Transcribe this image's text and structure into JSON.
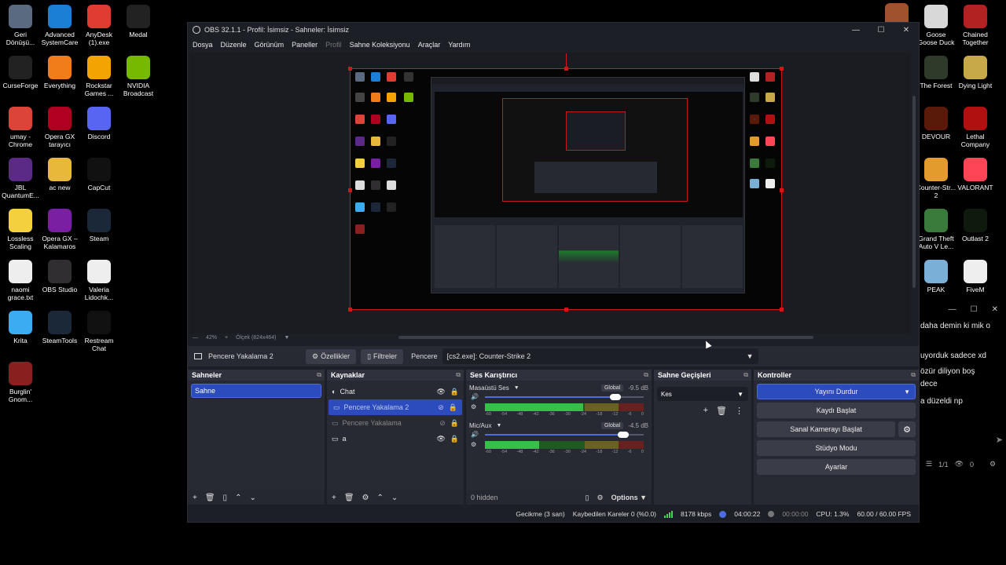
{
  "desktop_left": [
    {
      "label": "Geri Dönüşü...",
      "icon": "recycle-bin-icon",
      "color": "#5a6a80"
    },
    {
      "label": "Advanced SystemCare",
      "icon": "advanced-systemcare-icon",
      "color": "#1c7fd6"
    },
    {
      "label": "AnyDesk (1).exe",
      "icon": "anydesk-icon",
      "color": "#e03c31"
    },
    {
      "label": "Medal",
      "icon": "medal-icon",
      "color": "#222"
    },
    {
      "label": "CurseForge",
      "icon": "curseforge-icon",
      "color": "#222"
    },
    {
      "label": "Everything",
      "icon": "everything-icon",
      "color": "#f07c1a"
    },
    {
      "label": "Rockstar Games ...",
      "icon": "rockstar-icon",
      "color": "#f4a400"
    },
    {
      "label": "NVIDIA Broadcast",
      "icon": "nvidia-broadcast-icon",
      "color": "#76b900"
    },
    {
      "label": "umay - Chrome",
      "icon": "chrome-icon",
      "color": "#db4437"
    },
    {
      "label": "Opera GX tarayıcı",
      "icon": "opera-gx-icon",
      "color": "#b00020"
    },
    {
      "label": "Discord",
      "icon": "discord-icon",
      "color": "#5865f2"
    },
    {
      "label": "JBL QuantumE...",
      "icon": "jbl-icon",
      "color": "#5b2a86"
    },
    {
      "label": "ac new",
      "icon": "folder-icon",
      "color": "#e8b83a"
    },
    {
      "label": "CapCut",
      "icon": "capcut-icon",
      "color": "#111"
    },
    {
      "label": "Lossless Scaling",
      "icon": "lossless-scaling-icon",
      "color": "#f4d03f"
    },
    {
      "label": "Opera GX – Kalamaros",
      "icon": "opera-gx-icon",
      "color": "#7a1fa2"
    },
    {
      "label": "Steam",
      "icon": "steam-icon",
      "color": "#1b2838"
    },
    {
      "label": "naomi grace.txt",
      "icon": "text-file-icon",
      "color": "#eeeeee"
    },
    {
      "label": "OBS Studio",
      "icon": "obs-icon",
      "color": "#302e31"
    },
    {
      "label": "Valeria Lidochk...",
      "icon": "text-file-icon",
      "color": "#eeeeee"
    },
    {
      "label": "Krita",
      "icon": "krita-icon",
      "color": "#3babf2"
    },
    {
      "label": "SteamTools",
      "icon": "steamtools-icon",
      "color": "#1b2838"
    },
    {
      "label": "Restream Chat",
      "icon": "restream-icon",
      "color": "#111"
    },
    {
      "label": "Burglin' Gnom...",
      "icon": "burglin-gnomes-icon",
      "color": "#8a1f1f"
    }
  ],
  "desktop_right": [
    {
      "label": "",
      "icon": "game-icon",
      "color": "#a0522d"
    },
    {
      "label": "Goose Goose Duck",
      "icon": "goose-goose-duck-icon",
      "color": "#d8d8d8"
    },
    {
      "label": "Chained Together",
      "icon": "chained-together-icon",
      "color": "#b22222"
    },
    {
      "label": "The Forest",
      "icon": "the-forest-icon",
      "color": "#2e3b2a"
    },
    {
      "label": "Dying Light",
      "icon": "dying-light-icon",
      "color": "#c8a94a"
    },
    {
      "label": "DEVOUR",
      "icon": "devour-icon",
      "color": "#5a1a0a"
    },
    {
      "label": "Lethal Company",
      "icon": "lethal-company-icon",
      "color": "#b01010"
    },
    {
      "label": "Counter-Str... 2",
      "icon": "counter-strike-icon",
      "color": "#e39b2d"
    },
    {
      "label": "VALORANT",
      "icon": "valorant-icon",
      "color": "#fd4556"
    },
    {
      "label": "Grand Theft Auto V Le...",
      "icon": "gta-icon",
      "color": "#3a7a3a"
    },
    {
      "label": "Outlast 2",
      "icon": "outlast-icon",
      "color": "#0e1a0e"
    },
    {
      "label": "PEAK",
      "icon": "peak-icon",
      "color": "#7ab0d8"
    },
    {
      "label": "FiveM",
      "icon": "fivem-icon",
      "color": "#eeeeee"
    }
  ],
  "chat": {
    "lines": [
      "daha demin ki mik o",
      "uyorduk sadece xd",
      "özür diliyon boş",
      "dece",
      "a düzeldi np"
    ],
    "footer_count": "1/1",
    "footer_viewers": "0"
  },
  "obs": {
    "title": "OBS 32.1.1 - Profil: İsimsiz - Sahneler: İsimsiz",
    "menu": [
      "Dosya",
      "Düzenle",
      "Görünüm",
      "Paneller",
      "Profil",
      "Sahne Koleksiyonu",
      "Araçlar",
      "Yardım"
    ],
    "zoom": "42%",
    "scale_label": "Ölçek (824x464)",
    "context": {
      "source_name": "Pencere Yakalama 2",
      "properties": "Özellikler",
      "filters": "Filtreler",
      "window_label": "Pencere",
      "window_value": "[cs2.exe]: Counter-Strike 2"
    },
    "scenes": {
      "title": "Sahneler",
      "items": [
        "Sahne"
      ]
    },
    "sources": {
      "title": "Kaynaklar",
      "items": [
        {
          "name": "Chat",
          "icon": "browser-icon",
          "state": "normal"
        },
        {
          "name": "Pencere Yakalama 2",
          "icon": "window-icon",
          "state": "selected"
        },
        {
          "name": "Pencere Yakalama",
          "icon": "window-icon",
          "state": "hidden"
        },
        {
          "name": "a",
          "icon": "monitor-icon",
          "state": "normal"
        }
      ]
    },
    "mixer": {
      "title": "Ses Karıştırıcı",
      "channels": [
        {
          "name": "Masaüstü Ses",
          "badge": "Global",
          "db": "-9.5 dB",
          "volume": 0.82,
          "level": 0.62
        },
        {
          "name": "Mic/Aux",
          "badge": "Global",
          "db": "-4.5 dB",
          "volume": 0.87,
          "level": 0.34
        }
      ],
      "ticks": [
        "-60",
        "-54",
        "-48",
        "-42",
        "-36",
        "-30",
        "-24",
        "-18",
        "-12",
        "-6",
        "0"
      ],
      "hidden": "0 hidden",
      "options": "Options"
    },
    "transitions": {
      "title": "Sahne Geçişleri",
      "value": "Kes"
    },
    "controls": {
      "title": "Kontroller",
      "stop_stream": "Yayını Durdur",
      "start_record": "Kaydı Başlat",
      "virtual_cam": "Sanal Kamerayı Başlat",
      "studio_mode": "Stüdyo Modu",
      "settings": "Ayarlar"
    },
    "status": {
      "delay": "Gecikme (3 san)",
      "dropped": "Kaybedilen Kareler 0 (%0.0)",
      "bitrate": "8178 kbps",
      "live_time": "04:00:22",
      "rec_time": "00:00:00",
      "cpu": "CPU: 1.3%",
      "fps": "60.00 / 60.00 FPS"
    }
  },
  "colors": {
    "accent": "#2c4bbd",
    "selection_border": "#d01818",
    "meter_green": "#3fd84f"
  }
}
